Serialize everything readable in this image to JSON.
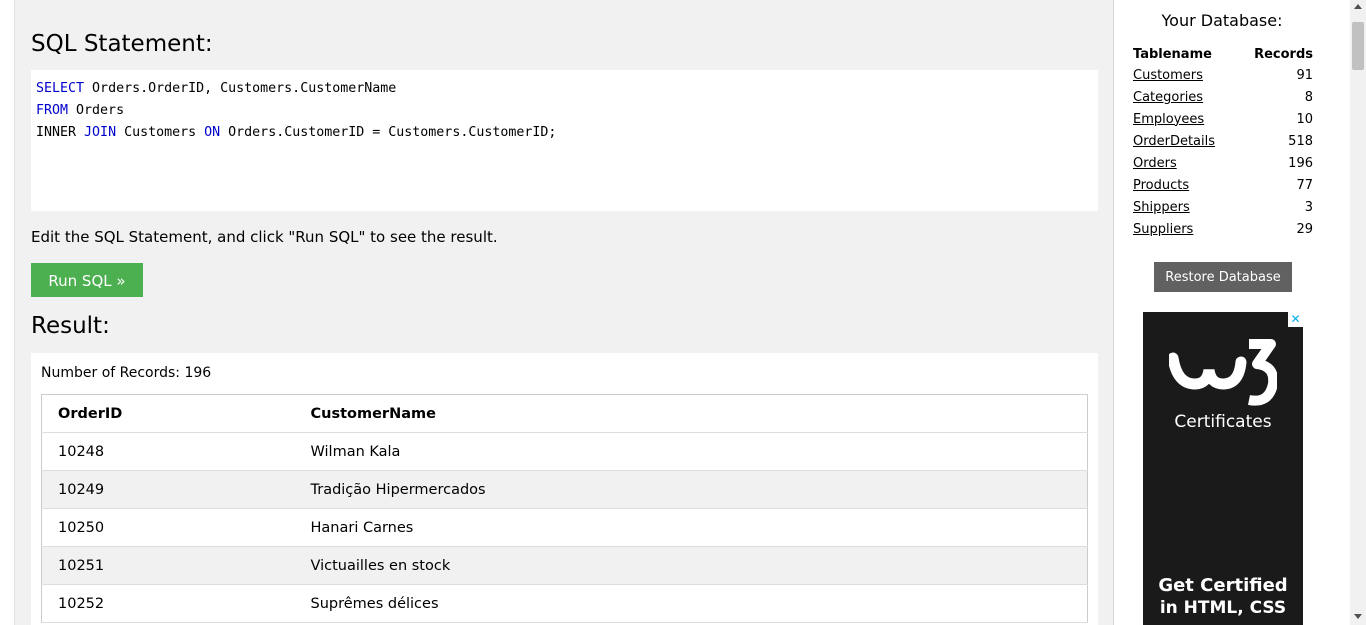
{
  "sql_panel": {
    "heading": "SQL Statement:",
    "code": {
      "line1_kw": "SELECT",
      "line1_rest": " Orders.OrderID, Customers.CustomerName",
      "line2_kw": "FROM",
      "line2_rest": " Orders",
      "line3_a": "INNER ",
      "line3_kw1": "JOIN",
      "line3_b": " Customers ",
      "line3_kw2": "ON",
      "line3_c": " Orders.CustomerID = Customers.CustomerID;"
    },
    "hint": "Edit the SQL Statement, and click \"Run SQL\" to see the result.",
    "run_label": "Run SQL »"
  },
  "result": {
    "heading": "Result:",
    "count_text": "Number of Records: 196",
    "columns": [
      "OrderID",
      "CustomerName"
    ],
    "rows": [
      [
        "10248",
        "Wilman Kala"
      ],
      [
        "10249",
        "Tradição Hipermercados"
      ],
      [
        "10250",
        "Hanari Carnes"
      ],
      [
        "10251",
        "Victuailles en stock"
      ],
      [
        "10252",
        "Suprêmes délices"
      ]
    ]
  },
  "database": {
    "title": "Your Database:",
    "col_table": "Tablename",
    "col_records": "Records",
    "tables": [
      {
        "name": "Customers",
        "records": "91"
      },
      {
        "name": "Categories",
        "records": "8"
      },
      {
        "name": "Employees",
        "records": "10"
      },
      {
        "name": "OrderDetails",
        "records": "518"
      },
      {
        "name": "Orders",
        "records": "196"
      },
      {
        "name": "Products",
        "records": "77"
      },
      {
        "name": "Shippers",
        "records": "3"
      },
      {
        "name": "Suppliers",
        "records": "29"
      }
    ],
    "restore_label": "Restore Database"
  },
  "ad": {
    "close": "✕",
    "logo_text": "w3",
    "cert_text": "Certificates",
    "line1": "Get Certified",
    "line2": "in HTML, CSS"
  },
  "colors": {
    "run_button": "#4caf50",
    "keyword": "#0000cd",
    "restore_button": "#616161"
  }
}
